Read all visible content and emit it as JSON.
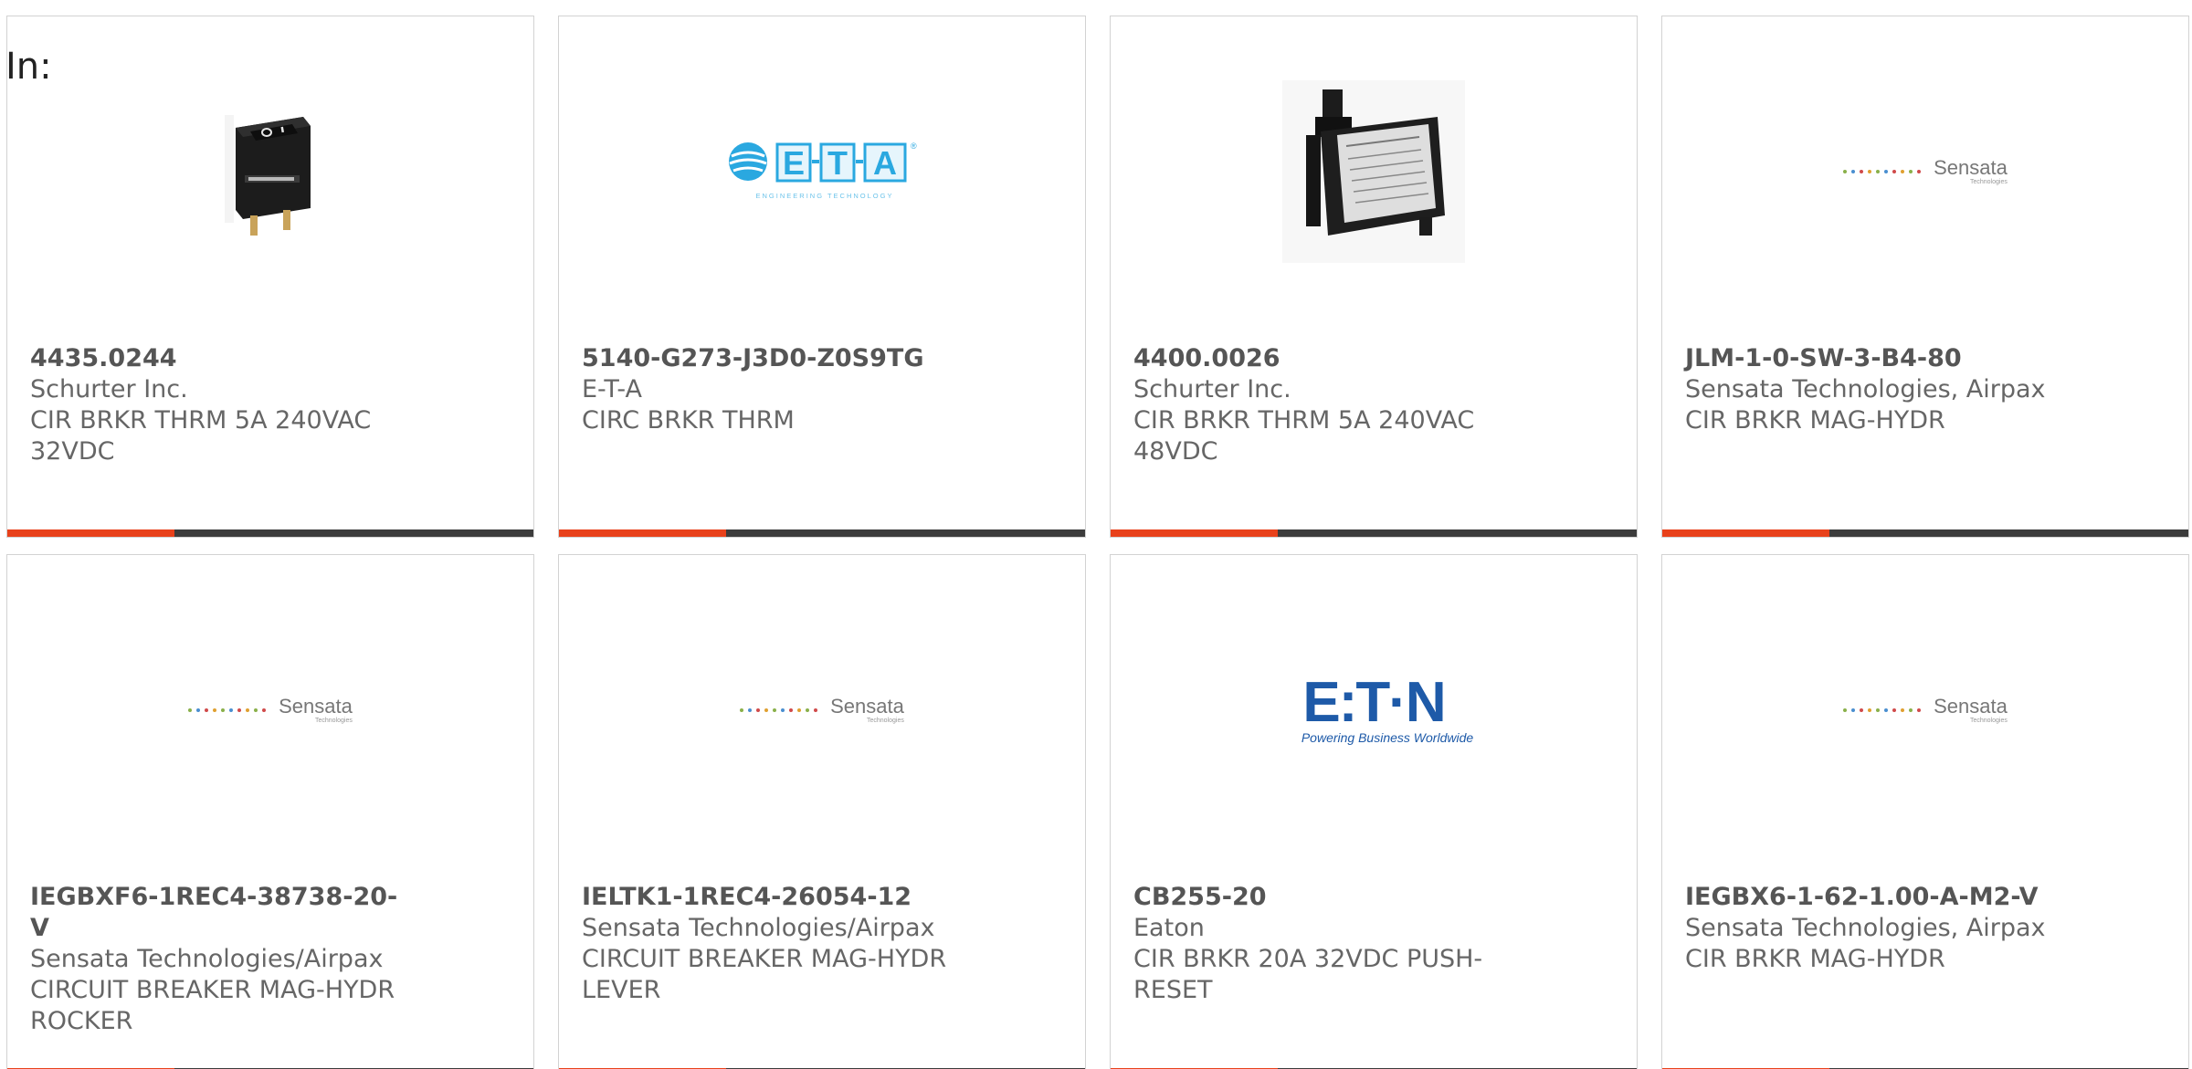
{
  "header": {
    "in_label": "In:"
  },
  "colors": {
    "accent_bar": "#e8411b",
    "dark_bar": "#3c3c3c",
    "eta_blue": "#2aa8e0",
    "eaton_blue": "#1e5aa8"
  },
  "products": [
    {
      "part_number": "4435.0244",
      "manufacturer": "Schurter Inc.",
      "description_line1": "CIR BRKR THRM 5A 240VAC",
      "description_line2": "32VDC",
      "image": "rocker-breaker-photo"
    },
    {
      "part_number": "5140-G273-J3D0-Z0S9TG",
      "manufacturer": "E-T-A",
      "description_line1": "CIRC BRKR THRM",
      "description_line2": "",
      "image": "eta-logo",
      "logo_text": "E-T-A",
      "logo_subtext": "ENGINEERING TECHNOLOGY",
      "logo_registered": "®"
    },
    {
      "part_number": "4400.0026",
      "manufacturer": "Schurter Inc.",
      "description_line1": "CIR BRKR THRM 5A 240VAC",
      "description_line2": "48VDC",
      "image": "push-breaker-photo"
    },
    {
      "part_number": "JLM-1-0-SW-3-B4-80",
      "manufacturer": "Sensata Technologies, Airpax",
      "description_line1": "CIR BRKR MAG-HYDR",
      "description_line2": "",
      "image": "sensata-logo",
      "logo_text": "Sensata",
      "logo_subtext": "Technologies"
    },
    {
      "part_number": "IEGBXF6-1REC4-38738-20-V",
      "manufacturer": "Sensata Technologies/Airpax",
      "description_line1": "CIRCUIT BREAKER MAG-HYDR",
      "description_line2": "ROCKER",
      "image": "sensata-logo",
      "logo_text": "Sensata",
      "logo_subtext": "Technologies"
    },
    {
      "part_number": "IELTK1-1REC4-26054-12",
      "manufacturer": "Sensata Technologies/Airpax",
      "description_line1": "CIRCUIT BREAKER MAG-HYDR",
      "description_line2": "LEVER",
      "image": "sensata-logo",
      "logo_text": "Sensata",
      "logo_subtext": "Technologies"
    },
    {
      "part_number": "CB255-20",
      "manufacturer": "Eaton",
      "description_line1": "CIR BRKR 20A 32VDC PUSH-",
      "description_line2": "RESET",
      "image": "eaton-logo",
      "logo_text": "E:T·N",
      "logo_subtext": "Powering Business Worldwide"
    },
    {
      "part_number": "IEGBX6-1-62-1.00-A-M2-V",
      "manufacturer": "Sensata Technologies, Airpax",
      "description_line1": "CIR BRKR MAG-HYDR",
      "description_line2": "",
      "image": "sensata-logo",
      "logo_text": "Sensata",
      "logo_subtext": "Technologies"
    }
  ]
}
